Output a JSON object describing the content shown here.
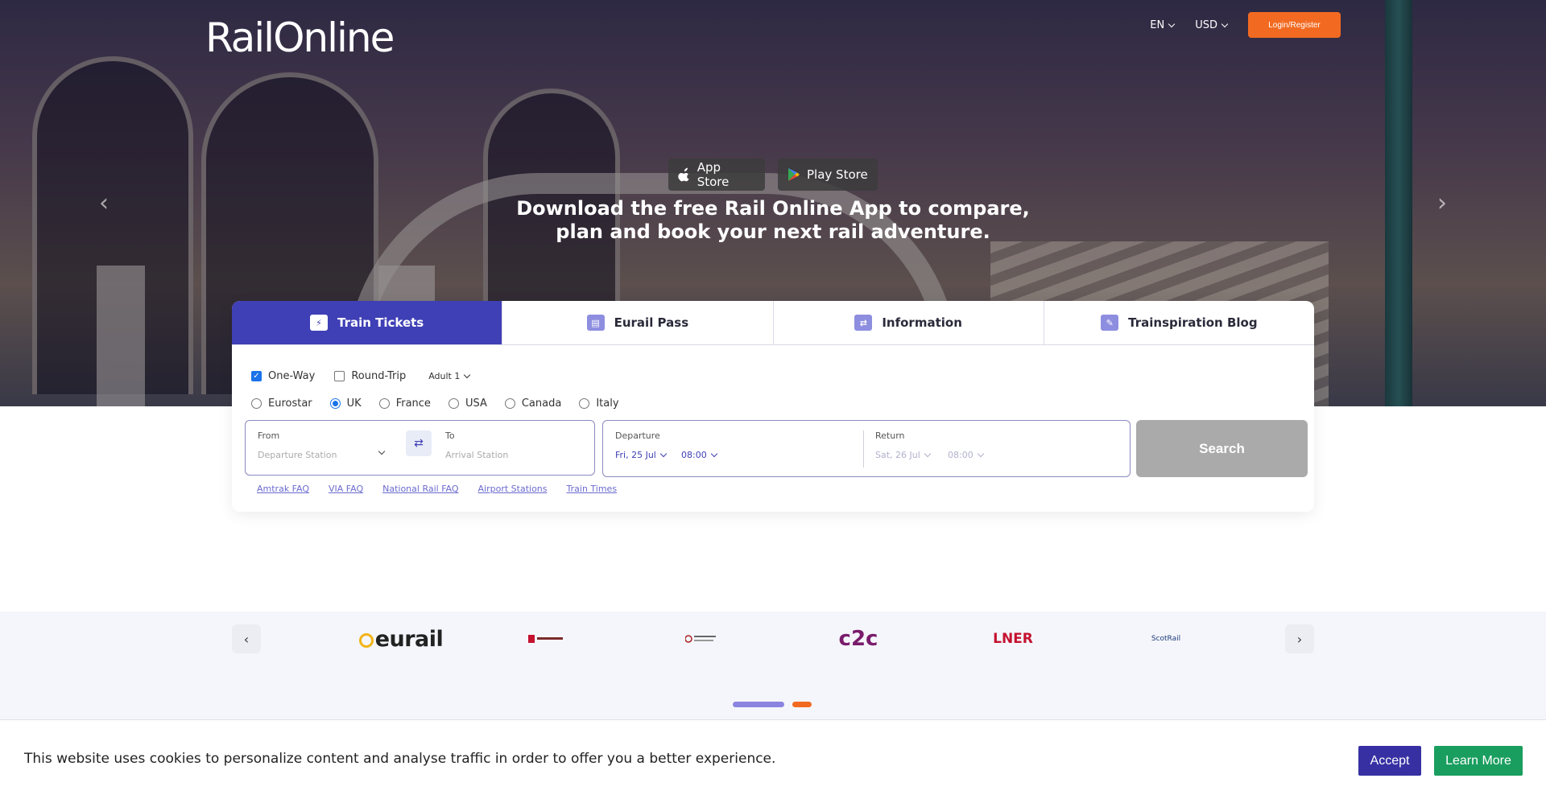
{
  "header": {
    "logo": "RailOnline",
    "language": "EN",
    "currency": "USD",
    "login_label": "Login/Register"
  },
  "hero": {
    "app_store_label": "App Store",
    "play_store_label": "Play Store",
    "heading_line1": "Download the free Rail Online App to compare,",
    "heading_line2": "plan and book your next rail adventure.",
    "prev_arrow": "‹",
    "next_arrow": "›"
  },
  "tabs": [
    {
      "label": "Train Tickets",
      "active": true
    },
    {
      "label": "Eurail Pass",
      "active": false
    },
    {
      "label": "Information",
      "active": false
    },
    {
      "label": "Trainspiration Blog",
      "active": false
    }
  ],
  "trip_options": {
    "one_way": {
      "label": "One-Way",
      "checked": true
    },
    "round_trip": {
      "label": "Round-Trip",
      "checked": false
    },
    "passengers": "Adult 1"
  },
  "regions": [
    {
      "label": "Eurostar",
      "selected": false
    },
    {
      "label": "UK",
      "selected": true
    },
    {
      "label": "France",
      "selected": false
    },
    {
      "label": "USA",
      "selected": false
    },
    {
      "label": "Canada",
      "selected": false
    },
    {
      "label": "Italy",
      "selected": false
    }
  ],
  "search": {
    "from_label": "From",
    "from_placeholder": "Departure Station",
    "to_label": "To",
    "to_placeholder": "Arrival Station",
    "departure_label": "Departure",
    "departure_date": "Fri, 25 Jul",
    "departure_time": "08:00",
    "return_label": "Return",
    "return_date": "Sat, 26 Jul",
    "return_time": "08:00",
    "search_label": "Search"
  },
  "quick_links": [
    "Amtrak FAQ",
    "VIA FAQ",
    "National Rail FAQ",
    "Airport Stations",
    "Train Times"
  ],
  "partners": {
    "eurail": "eurail",
    "c2c": "c2c",
    "lner": "LNER",
    "scotrail": "ScotRail",
    "prev": "‹",
    "next": "›"
  },
  "cookie": {
    "text": "This website uses cookies to personalize content and analyse traffic in order to offer you a better experience.",
    "accept_label": "Accept",
    "learn_label": "Learn More"
  },
  "colors": {
    "brand_primary": "#3f3fb6",
    "brand_accent": "#f26a21",
    "accept": "#3730a3",
    "learn_more": "#1a9e5f"
  }
}
